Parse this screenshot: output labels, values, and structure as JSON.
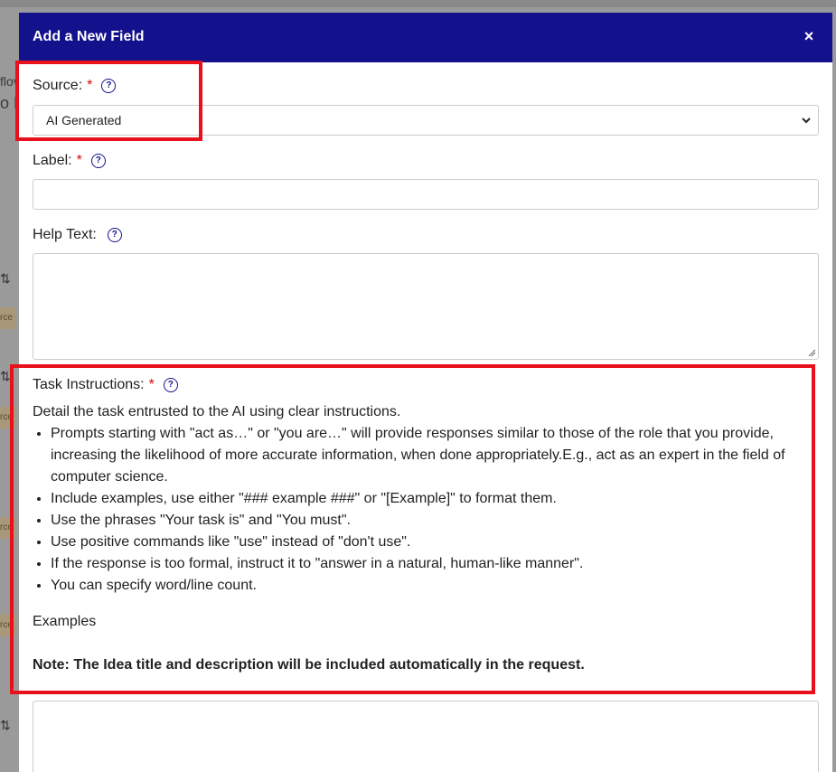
{
  "background": {
    "fragments": [
      "flov",
      "o F"
    ],
    "tag_text": "rce"
  },
  "modal": {
    "title": "Add a New Field",
    "close_label": "×"
  },
  "source": {
    "label": "Source:",
    "required": "*",
    "selected": "AI Generated"
  },
  "label_field": {
    "label": "Label:",
    "required": "*",
    "value": ""
  },
  "help_text": {
    "label": "Help Text:",
    "value": ""
  },
  "task_instructions": {
    "label": "Task Instructions:",
    "required": "*",
    "intro": "Detail the task entrusted to the AI using clear instructions.",
    "bullets": [
      "Prompts starting with \"act as…\" or \"you are…\" will provide responses similar to those of the role that you provide, increasing the likelihood of more accurate information, when done appropriately.E.g., act as an expert in the field of computer science.",
      "Include examples, use either \"### example ###\" or \"[Example]\" to format them.",
      "Use the phrases \"Your task is\" and \"You must\".",
      "Use positive commands like \"use\" instead of \"don't use\".",
      "If the response is too formal, instruct it to \"answer in a natural, human-like manner\".",
      "You can specify word/line count."
    ],
    "examples_label": "Examples",
    "note": "Note: The Idea title and description will be included automatically in the request.",
    "value": ""
  },
  "colors": {
    "header": "#13118c",
    "highlight": "#e8101a",
    "required": "#dd0000"
  },
  "icons": {
    "help": "question-circle-icon",
    "close": "close-icon",
    "chevron": "chevron-down-icon"
  }
}
